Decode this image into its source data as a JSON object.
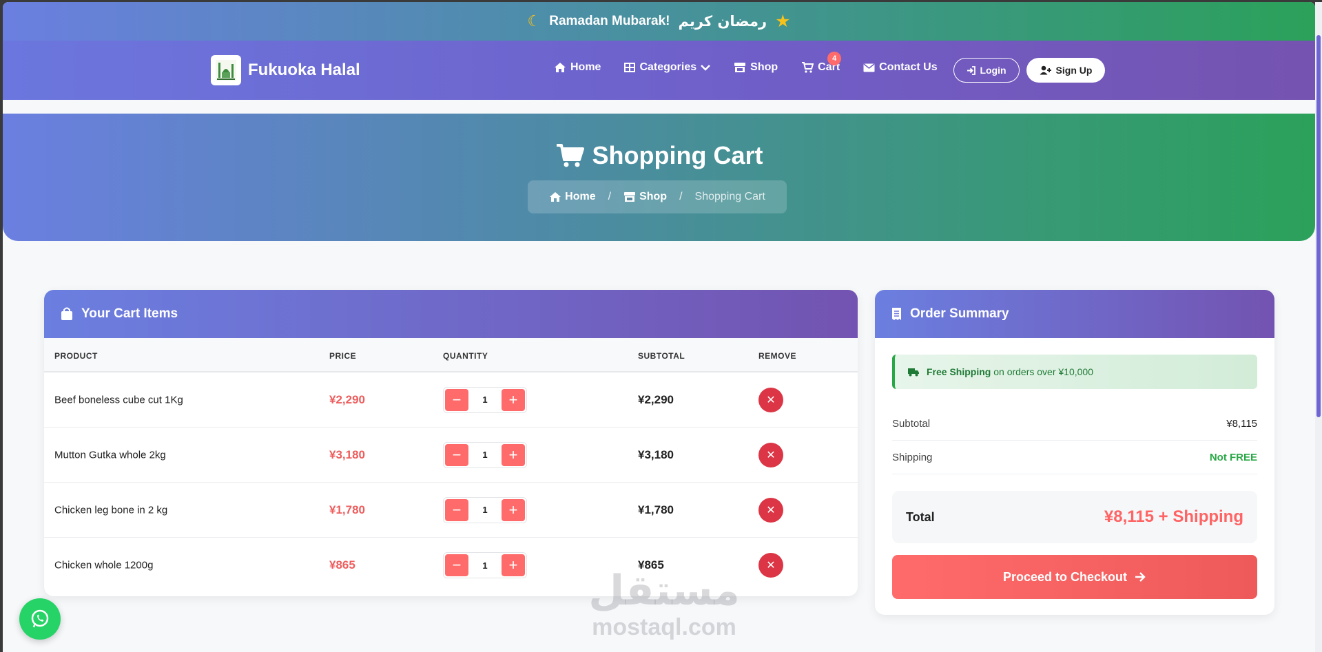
{
  "announcement": {
    "text_en": "Ramadan Mubarak!",
    "text_ar": "رمضان كريم",
    "moon_icon": "moon-icon",
    "star_icon": "star-icon"
  },
  "brand": {
    "name": "Fukuoka Halal",
    "logo_icon": "mosque-logo"
  },
  "nav": {
    "home": "Home",
    "categories": "Categories",
    "shop": "Shop",
    "cart": "Cart",
    "cart_count": "4",
    "contact": "Contact Us",
    "login": "Login",
    "signup": "Sign Up"
  },
  "hero": {
    "title": "Shopping Cart",
    "breadcrumb": {
      "home": "Home",
      "sep": "/",
      "shop": "Shop",
      "current": "Shopping Cart"
    }
  },
  "cart": {
    "heading": "Your Cart Items",
    "columns": {
      "product": "PRODUCT",
      "price": "PRICE",
      "quantity": "QUANTITY",
      "subtotal": "SUBTOTAL",
      "remove": "REMOVE"
    },
    "items": [
      {
        "name": "Beef boneless cube cut 1Kg",
        "price": "¥2,290",
        "qty": "1",
        "subtotal": "¥2,290"
      },
      {
        "name": "Mutton Gutka whole 2kg",
        "price": "¥3,180",
        "qty": "1",
        "subtotal": "¥3,180"
      },
      {
        "name": "Chicken leg bone in 2 kg",
        "price": "¥1,780",
        "qty": "1",
        "subtotal": "¥1,780"
      },
      {
        "name": "Chicken whole 1200g",
        "price": "¥865",
        "qty": "1",
        "subtotal": "¥865"
      }
    ]
  },
  "summary": {
    "heading": "Order Summary",
    "free_shipping_bold": "Free Shipping",
    "free_shipping_rest": "on orders over ¥10,000",
    "subtotal_label": "Subtotal",
    "subtotal_value": "¥8,115",
    "shipping_label": "Shipping",
    "shipping_value": "Not FREE",
    "total_label": "Total",
    "total_value": "¥8,115 + Shipping",
    "checkout_label": "Proceed to Checkout"
  },
  "watermark": {
    "arabic": "مستقل",
    "latin": "mostaql.com"
  },
  "colors": {
    "accent_coral": "#ff6b6b",
    "purple": "#7353b1",
    "green": "#28a745",
    "danger": "#dc3545"
  }
}
